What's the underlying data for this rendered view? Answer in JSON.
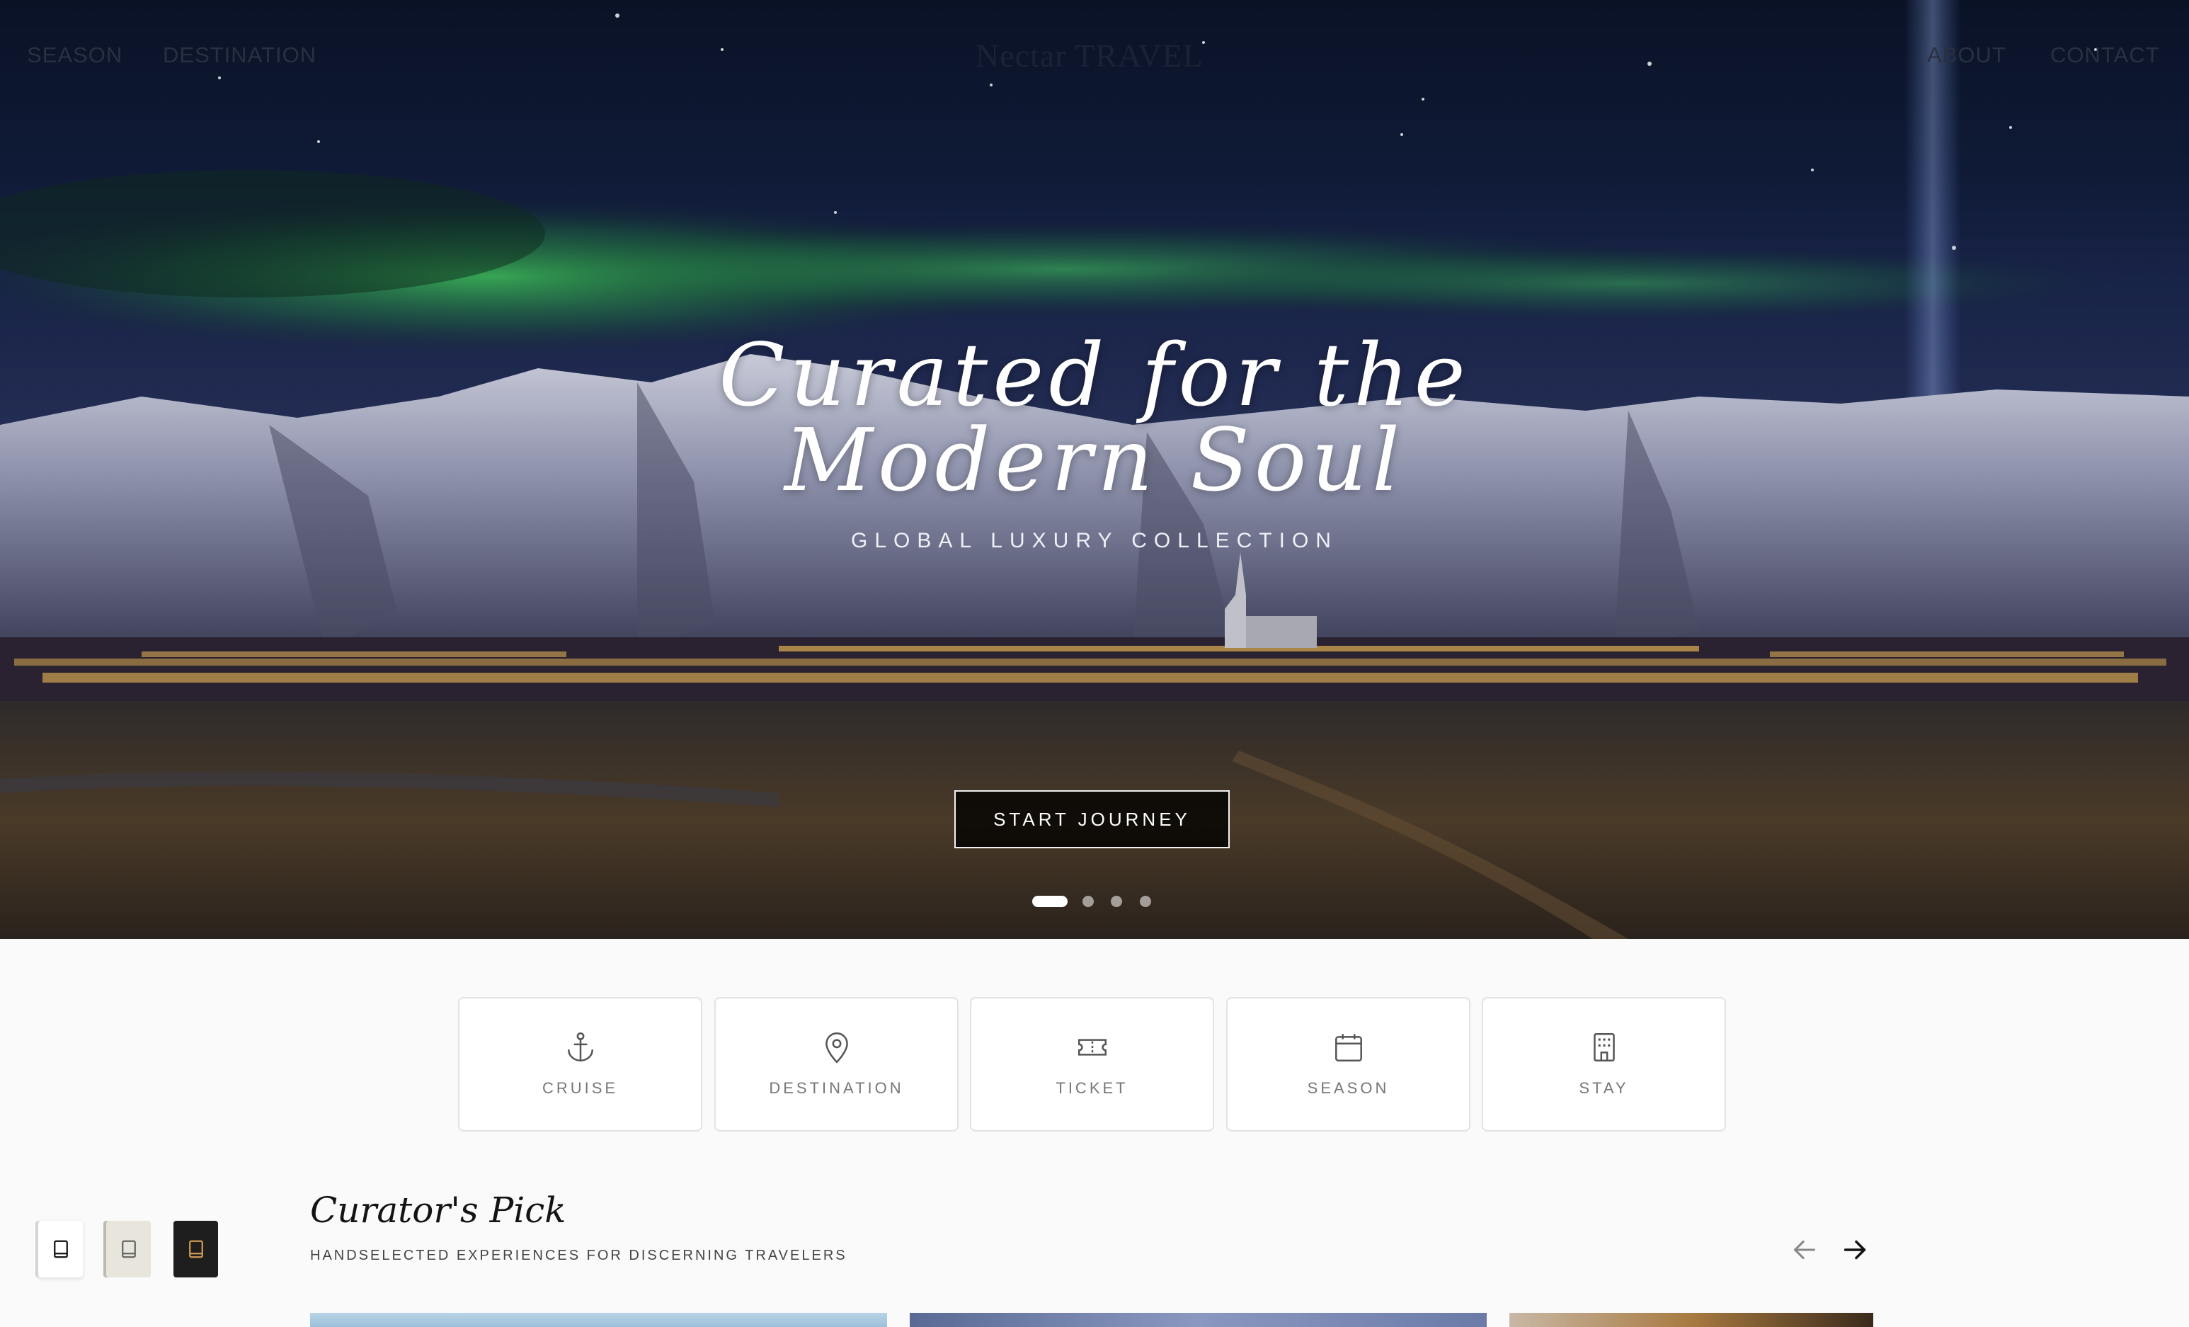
{
  "nav": {
    "left": [
      "SEASON",
      "DESTINATION"
    ],
    "brand": "Nectar TRAVEL",
    "right": [
      "ABOUT",
      "CONTACT"
    ]
  },
  "hero": {
    "title_line1": "Curated for the",
    "title_line2": "Modern Soul",
    "subtitle": "GLOBAL LUXURY COLLECTION",
    "cta": "START JOURNEY",
    "slides": 4,
    "active_slide": 1
  },
  "categories": [
    {
      "label": "CRUISE",
      "icon": "anchor-icon"
    },
    {
      "label": "DESTINATION",
      "icon": "map-pin-icon"
    },
    {
      "label": "TICKET",
      "icon": "ticket-icon"
    },
    {
      "label": "SEASON",
      "icon": "calendar-icon"
    },
    {
      "label": "STAY",
      "icon": "building-icon"
    }
  ],
  "curator": {
    "title": "Curator's Pick",
    "subtitle": "HANDSELECTED EXPERIENCES FOR DISCERNING TRAVELERS"
  },
  "theme_switcher": [
    {
      "name": "light",
      "icon": "book-icon",
      "bg": "#ffffff",
      "fg": "#111111"
    },
    {
      "name": "sepia",
      "icon": "book-icon",
      "bg": "#e7e5dc",
      "fg": "#666666"
    },
    {
      "name": "dark",
      "icon": "book-icon",
      "bg": "#1e1e1e",
      "fg": "#d09a52"
    }
  ],
  "colors": {
    "aurora": "#2fa24a",
    "city_lights": "#ffc85a",
    "page_bg": "#fafafa"
  }
}
